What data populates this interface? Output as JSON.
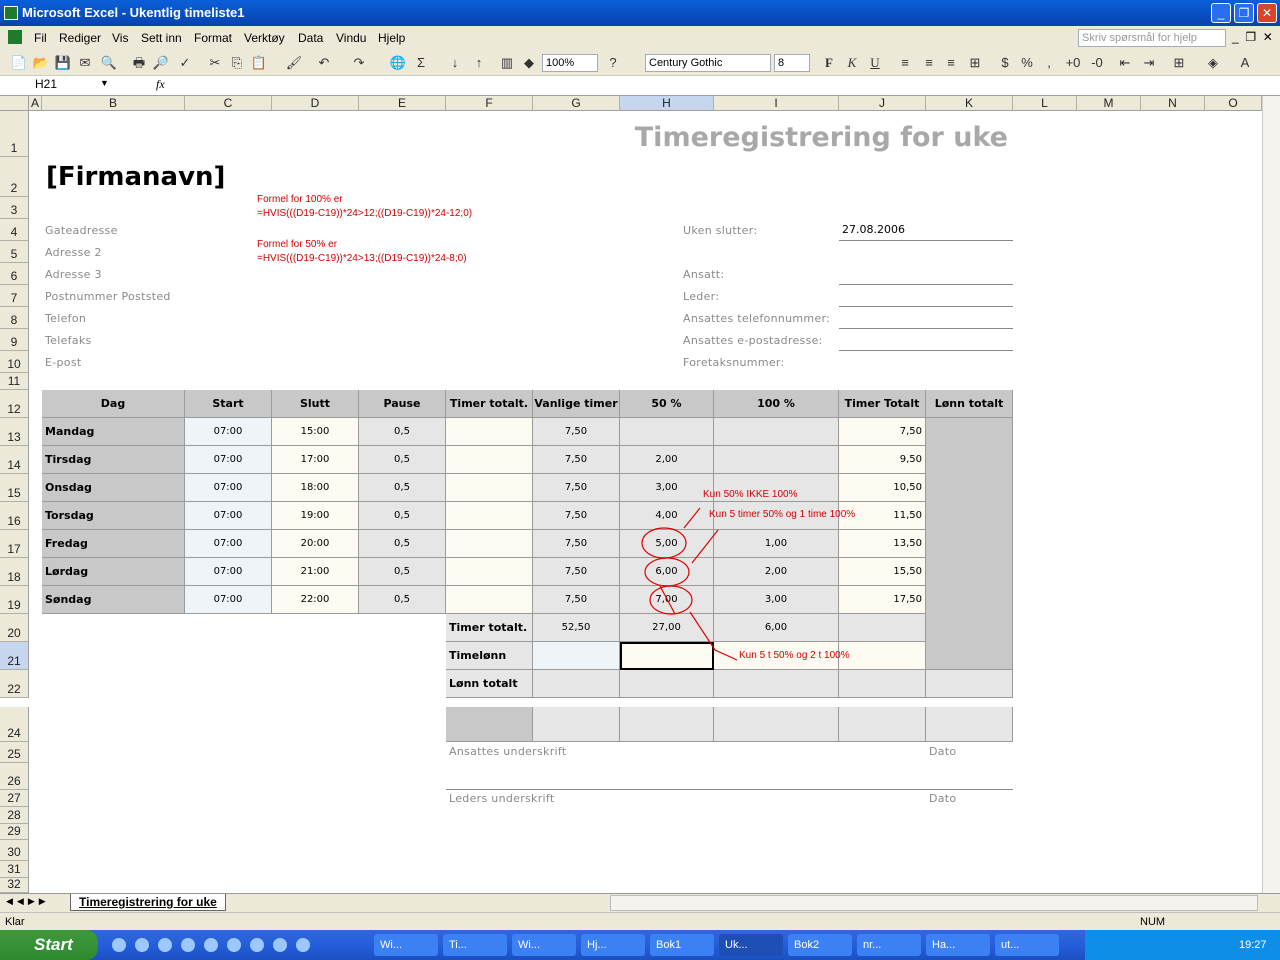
{
  "window": {
    "title": "Microsoft Excel - Ukentlig timeliste1"
  },
  "menu": [
    "Fil",
    "Rediger",
    "Vis",
    "Sett inn",
    "Format",
    "Verktøy",
    "Data",
    "Vindu",
    "Hjelp"
  ],
  "help_placeholder": "Skriv spørsmål for hjelp",
  "toolbar": {
    "zoom": "100%",
    "font": "Century Gothic",
    "size": "8",
    "bold": "F",
    "italic": "K",
    "underline": "U"
  },
  "name_box": "H21",
  "fx": "fx",
  "columns": [
    "A",
    "B",
    "C",
    "D",
    "E",
    "F",
    "G",
    "H",
    "I",
    "J",
    "K",
    "L",
    "M",
    "N",
    "O"
  ],
  "rows": [
    "1",
    "2",
    "3",
    "4",
    "5",
    "6",
    "7",
    "8",
    "9",
    "10",
    "11",
    "12",
    "13",
    "14",
    "15",
    "16",
    "17",
    "18",
    "19",
    "20",
    "21",
    "22",
    "24",
    "25",
    "26",
    "27",
    "28",
    "29",
    "30",
    "31",
    "32"
  ],
  "sheet": {
    "title": "Timeregistrering for uke",
    "company": "[Firmanavn]",
    "address": [
      "Gateadresse",
      "Adresse 2",
      "Adresse 3",
      "Postnummer Poststed",
      "Telefon",
      "Telefaks",
      "E-post"
    ],
    "notes": [
      "Formel for 100% er",
      "=HVIS(((D19-C19))*24>12;((D19-C19))*24-12;0)",
      "Formel for 50% er",
      "=HVIS(((D19-C19))*24>13;((D19-C19))*24-8;0)"
    ],
    "info_labels": [
      "Uken slutter:",
      "Ansatt:",
      "Leder:",
      "Ansattes telefonnummer:",
      "Ansattes e-postadresse:",
      "Foretaksnummer:"
    ],
    "week_end": "27.08.2006",
    "headers": [
      "Dag",
      "Start",
      "Slutt",
      "Pause",
      "Timer totalt.",
      "Vanlige timer",
      "50 %",
      "100 %",
      "Timer Totalt",
      "Lønn totalt"
    ],
    "days": [
      [
        "Mandag",
        "07:00",
        "15:00",
        "0,5",
        "",
        "7,50",
        "",
        "",
        "7,50"
      ],
      [
        "Tirsdag",
        "07:00",
        "17:00",
        "0,5",
        "",
        "7,50",
        "2,00",
        "",
        "9,50"
      ],
      [
        "Onsdag",
        "07:00",
        "18:00",
        "0,5",
        "",
        "7,50",
        "3,00",
        "",
        "10,50"
      ],
      [
        "Torsdag",
        "07:00",
        "19:00",
        "0,5",
        "",
        "7,50",
        "4,00",
        "",
        "11,50"
      ],
      [
        "Fredag",
        "07:00",
        "20:00",
        "0,5",
        "",
        "7,50",
        "5,00",
        "1,00",
        "13,50"
      ],
      [
        "Lørdag",
        "07:00",
        "21:00",
        "0,5",
        "",
        "7,50",
        "6,00",
        "2,00",
        "15,50"
      ],
      [
        "Søndag",
        "07:00",
        "22:00",
        "0,5",
        "",
        "7,50",
        "7,00",
        "3,00",
        "17,50"
      ]
    ],
    "totals_label": "Timer totalt.",
    "totals": [
      "52,50",
      "27,00",
      "6,00"
    ],
    "wage_label": "Timelønn",
    "pay_total_label": "Lønn totalt",
    "sig_employee": "Ansattes underskrift",
    "sig_manager": "Leders underskrift",
    "date": "Dato",
    "annotations": [
      "Kun 50% IKKE 100%",
      "Kun 5 timer 50% og 1 time 100%",
      "Kun 5 t 50% og 2 t 100%"
    ]
  },
  "sheet_tab": "Timeregistrering for uke",
  "status": {
    "left": "Klar",
    "num": "NUM"
  },
  "taskbar": {
    "start": "Start",
    "tasks": [
      "Wi...",
      "Ti...",
      "Wi...",
      "Hj...",
      "Bok1",
      "Uk...",
      "Bok2",
      "nr...",
      "Ha...",
      "ut..."
    ],
    "clock": "19:27"
  }
}
